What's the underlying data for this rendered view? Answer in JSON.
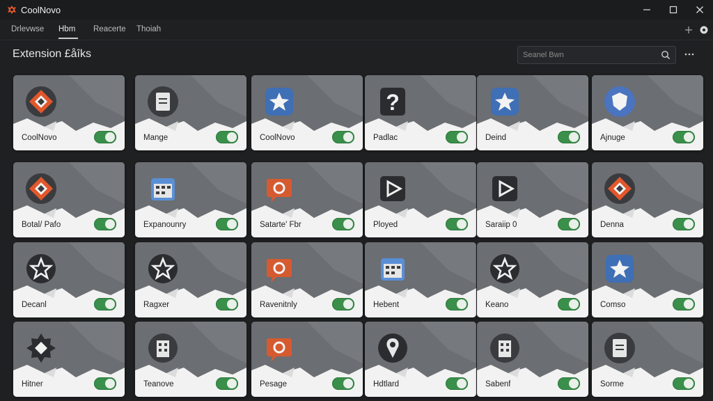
{
  "app": {
    "title": "CoolNovo"
  },
  "tabs": [
    {
      "label": "Drlevwse",
      "active": false
    },
    {
      "label": "Hbm",
      "active": true
    },
    {
      "label": "Reacerte",
      "active": false
    },
    {
      "label": "Thoiah",
      "active": false
    }
  ],
  "page": {
    "title": "Extension £åîks"
  },
  "search": {
    "placeholder": "Seanel Bwn"
  },
  "colors": {
    "accent_green": "#3a8f4a",
    "logo_orange": "#e2572b",
    "card_grey": "#6b6e72"
  },
  "extensions": [
    {
      "name": "CoolNovo",
      "icon": "orange-diamond-icon",
      "enabled": true
    },
    {
      "name": "Mange",
      "icon": "document-icon",
      "enabled": true
    },
    {
      "name": "CoolNovo",
      "icon": "blue-star-icon",
      "enabled": true
    },
    {
      "name": "Padlac",
      "icon": "question-icon",
      "enabled": true
    },
    {
      "name": "Deind",
      "icon": "blue-star-icon",
      "enabled": true
    },
    {
      "name": "Ajnuge",
      "icon": "blue-shield-icon",
      "enabled": true
    },
    {
      "name": "Botal/ Pafo",
      "icon": "orange-diamond-icon",
      "enabled": true
    },
    {
      "name": "Expanounry",
      "icon": "calendar-icon",
      "enabled": true
    },
    {
      "name": "Satarte' Fbr",
      "icon": "orange-chat-icon",
      "enabled": true
    },
    {
      "name": "Ployed",
      "icon": "play-icon",
      "enabled": true
    },
    {
      "name": "Saraiip 0",
      "icon": "play-icon",
      "enabled": true
    },
    {
      "name": "Denna",
      "icon": "orange-diamond-icon",
      "enabled": true
    },
    {
      "name": "Decanl",
      "icon": "star-icon",
      "enabled": true
    },
    {
      "name": "Ragxer",
      "icon": "star-icon",
      "enabled": true
    },
    {
      "name": "Ravenitnly",
      "icon": "orange-chat-icon",
      "enabled": true
    },
    {
      "name": "Hebent",
      "icon": "calendar-icon",
      "enabled": true
    },
    {
      "name": "Keano",
      "icon": "star-icon",
      "enabled": true
    },
    {
      "name": "Comso",
      "icon": "blue-star-icon",
      "enabled": true
    },
    {
      "name": "Hitner",
      "icon": "gear-icon",
      "enabled": true
    },
    {
      "name": "Teanove",
      "icon": "building-icon",
      "enabled": true
    },
    {
      "name": "Pesage",
      "icon": "orange-chat-icon",
      "enabled": true
    },
    {
      "name": "Hdtlard",
      "icon": "pin-icon",
      "enabled": true
    },
    {
      "name": "Sabenf",
      "icon": "building-icon",
      "enabled": true
    },
    {
      "name": "Sorme",
      "icon": "document-icon",
      "enabled": true
    }
  ]
}
